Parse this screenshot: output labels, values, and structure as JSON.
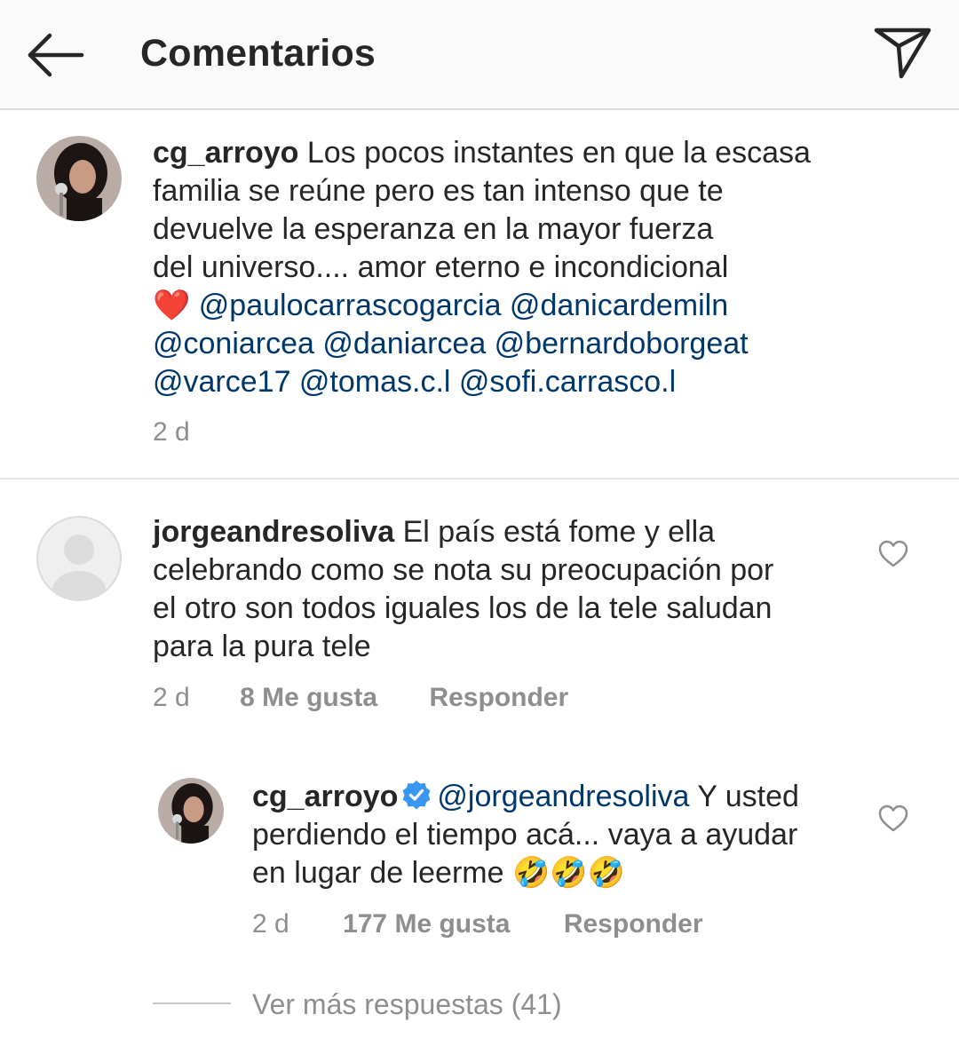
{
  "header": {
    "title": "Comentarios"
  },
  "comments": [
    {
      "username": "cg_arroyo",
      "text_lines": [
        "Los pocos instantes en que la escasa",
        "familia se reúne pero es tan intenso que te",
        "devuelve la esperanza en la mayor fuerza",
        "del universo.... amor eterno e incondicional"
      ],
      "emoji": "❤️",
      "mentions_line1": "@paulocarrascogarcia @danicardemiln",
      "mentions_line2": "@coniarcea @daniarcea @bernardoborgeat",
      "mentions_line3": "@varce17 @tomas.c.l @sofi.carrasco.l",
      "time": "2 d"
    },
    {
      "username": "jorgeandresoliva",
      "text_line1": "El país está fome y ella",
      "text_line2": "celebrando como se nota su preocupación por",
      "text_line3": "el otro son todos iguales los de la tele saludan",
      "text_line4": "para la pura tele",
      "time": "2 d",
      "likes": "8 Me gusta",
      "reply": "Responder",
      "reply_item": {
        "username": "cg_arroyo",
        "mention": "@jorgeandresoliva",
        "text_line1": "Y usted",
        "text_line2": "perdiendo el tiempo acá... vaya a ayudar",
        "text_line3": "en lugar de leerme",
        "emojis": "🤣🤣🤣",
        "time": "2 d",
        "likes": "177 Me gusta",
        "reply": "Responder"
      },
      "more_replies": "Ver más respuestas (41)"
    }
  ],
  "colors": {
    "header_bg": "#fafafa",
    "text": "#262626",
    "mention": "#00376b",
    "meta": "#8e8e8e",
    "verified": "#3897f0",
    "heart": "#e0245e"
  },
  "icons": [
    "back-arrow-icon",
    "send-icon",
    "heart-outline-icon",
    "verified-badge-icon",
    "avatar-placeholder-icon"
  ]
}
